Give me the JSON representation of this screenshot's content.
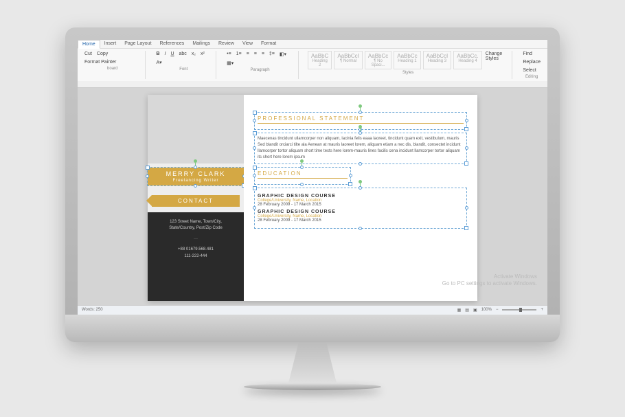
{
  "ribbon": {
    "tabs": [
      "Home",
      "Insert",
      "Page Layout",
      "References",
      "Mailings",
      "Review",
      "View",
      "Format"
    ],
    "active_tab": "Home",
    "clipboard": {
      "cut": "Cut",
      "copy": "Copy",
      "painter": "Format Painter",
      "label": "Clipboard"
    },
    "font": {
      "bold": "B",
      "italic": "I",
      "underline": "U",
      "label": "Font"
    },
    "paragraph": {
      "label": "Paragraph"
    },
    "styles": {
      "label": "Styles",
      "change": "Change Styles",
      "items": [
        {
          "preview": "AaBbC",
          "name": "Heading 2"
        },
        {
          "preview": "AaBbCcI",
          "name": "¶ Normal"
        },
        {
          "preview": "AaBbCc",
          "name": "¶ No Spaci..."
        },
        {
          "preview": "AaBbCc",
          "name": "Heading 1"
        },
        {
          "preview": "AaBbCcI",
          "name": "Heading 3"
        },
        {
          "preview": "AaBbCc.",
          "name": "Heading 4"
        }
      ]
    },
    "editing": {
      "find": "Find",
      "replace": "Replace",
      "select": "Select",
      "label": "Editing"
    }
  },
  "document": {
    "name_banner": {
      "name": "MERRY CLARK",
      "subtitle": "Freelancing Writer"
    },
    "contact_banner": "CONTACT",
    "contact_info": {
      "address": "123 Street Name, Town/City,\nState/Country, Post/Zip Code",
      "phone": "+88 01679.568.481",
      "alt_phone": "111-222-444"
    },
    "section1": {
      "title": "PROFESSIONAL STATEMENT",
      "body": "Maecenas tincidunt ullamcorper non aliquam, lacinia felis eaaa laoreet, tincidunt quam exit, vestibulum, mauris Sed blandit orciarci tilte ala Aenean at mauris laoreet lorem, aliquam etiam a nec dis, blandit, consectet incidunt llamcorper tortor aliquam short time texts here lorem-mauris lines facilis cena incidunt llamcorper tortor aliquam its short here lorem ipsum"
    },
    "section2": {
      "title": "EDUCATION",
      "items": [
        {
          "course": "GRAPHIC DESIGN COURSE",
          "school": "College/University, Name, Location",
          "dates": "28 February 2009 - 17 March 2015"
        },
        {
          "course": "GRAPHIC DESIGN COURSE",
          "school": "College/University, Name, Location",
          "dates": "28 February 2009 - 17 March 2015"
        }
      ]
    }
  },
  "statusbar": {
    "words": "Words: 250",
    "zoom": "100%"
  },
  "watermark": {
    "line1": "Activate Windows",
    "line2": "Go to PC settings to activate Windows."
  }
}
